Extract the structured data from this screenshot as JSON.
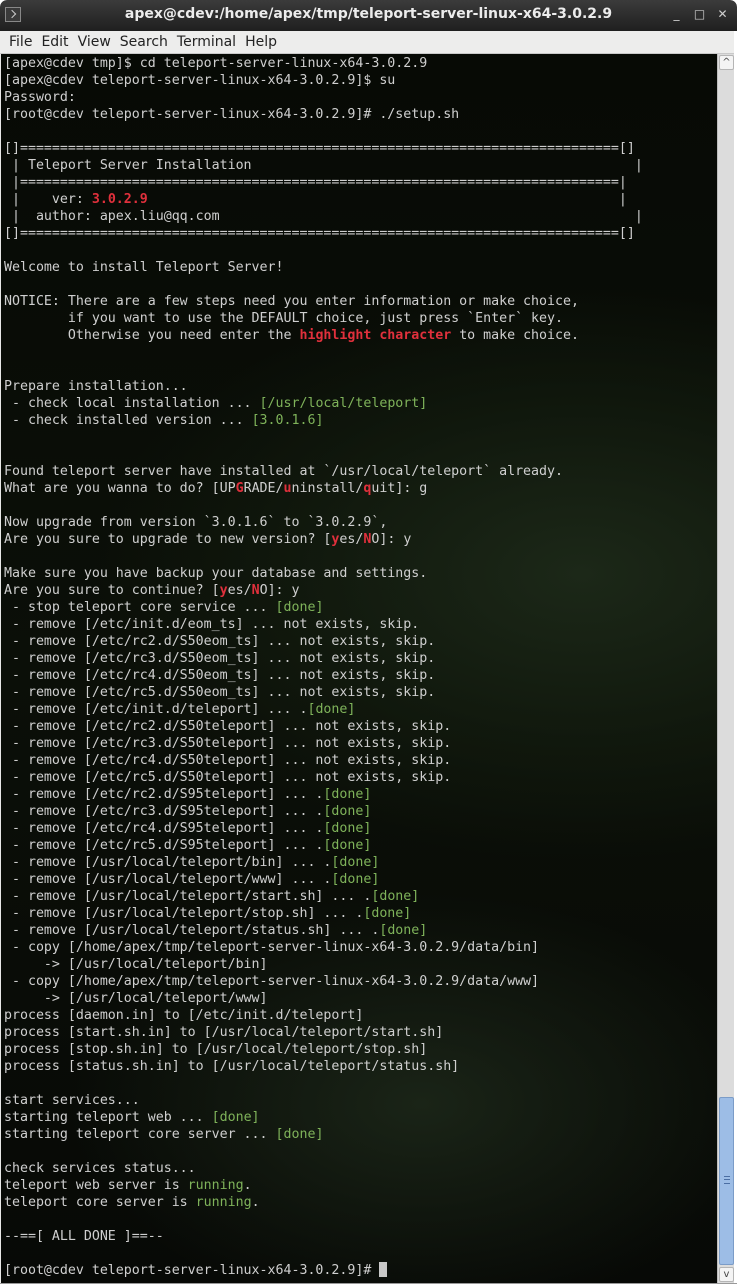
{
  "window": {
    "title": "apex@cdev:/home/apex/tmp/teleport-server-linux-x64-3.0.2.9",
    "icon": "terminal-icon",
    "controls": [
      {
        "name": "minimize",
        "glyph": "_"
      },
      {
        "name": "maximize",
        "glyph": "□"
      },
      {
        "name": "close",
        "glyph": "✕"
      }
    ]
  },
  "menu": [
    "File",
    "Edit",
    "View",
    "Search",
    "Terminal",
    "Help"
  ],
  "colors": {
    "terminal_bg": "#0a0d07",
    "text": "#cfcfcf",
    "highlight_red": "#e0303c",
    "done_green": "#7fb35a",
    "scrollbar_thumb": "#9dbde6"
  },
  "terminal": {
    "lines": [
      [
        {
          "t": "[apex@cdev tmp]$ cd teleport-server-linux-x64-3.0.2.9"
        }
      ],
      [
        {
          "t": "[apex@cdev teleport-server-linux-x64-3.0.2.9]$ su"
        }
      ],
      [
        {
          "t": "Password:"
        }
      ],
      [
        {
          "t": "[root@cdev teleport-server-linux-x64-3.0.2.9]# ./setup.sh"
        }
      ],
      [
        {
          "t": ""
        }
      ],
      [
        {
          "t": "[]===========================================================================[]"
        }
      ],
      [
        {
          "t": " | Teleport Server Installation                                                |"
        }
      ],
      [
        {
          "t": " |===========================================================================|"
        }
      ],
      [
        {
          "t": " |    ver: "
        },
        {
          "t": "3.0.2.9",
          "c": "r"
        },
        {
          "t": "                                                           |"
        }
      ],
      [
        {
          "t": " |  author: apex.liu@qq.com                                                    |"
        }
      ],
      [
        {
          "t": "[]===========================================================================[]"
        }
      ],
      [
        {
          "t": ""
        }
      ],
      [
        {
          "t": "Welcome to install Teleport Server!"
        }
      ],
      [
        {
          "t": ""
        }
      ],
      [
        {
          "t": "NOTICE: There are a few steps need you enter information or make choice,"
        }
      ],
      [
        {
          "t": "        if you want to use the DEFAULT choice, just press `Enter` key."
        }
      ],
      [
        {
          "t": "        Otherwise you need enter the "
        },
        {
          "t": "highlight character",
          "c": "r"
        },
        {
          "t": " to make choice."
        }
      ],
      [
        {
          "t": ""
        }
      ],
      [
        {
          "t": ""
        }
      ],
      [
        {
          "t": "Prepare installation..."
        }
      ],
      [
        {
          "t": " - check local installation ... "
        },
        {
          "t": "[/usr/local/teleport]",
          "c": "g"
        }
      ],
      [
        {
          "t": " - check installed version ... "
        },
        {
          "t": "[3.0.1.6]",
          "c": "g"
        }
      ],
      [
        {
          "t": ""
        }
      ],
      [
        {
          "t": ""
        }
      ],
      [
        {
          "t": "Found teleport server have installed at `/usr/local/teleport` already."
        }
      ],
      [
        {
          "t": "What are you wanna to do? [UP"
        },
        {
          "t": "G",
          "c": "r"
        },
        {
          "t": "RADE/"
        },
        {
          "t": "u",
          "c": "r"
        },
        {
          "t": "ninstall/"
        },
        {
          "t": "q",
          "c": "r"
        },
        {
          "t": "uit]: g"
        }
      ],
      [
        {
          "t": ""
        }
      ],
      [
        {
          "t": "Now upgrade from version `3.0.1.6` to `3.0.2.9`,"
        }
      ],
      [
        {
          "t": "Are you sure to upgrade to new version? ["
        },
        {
          "t": "y",
          "c": "r"
        },
        {
          "t": "es/"
        },
        {
          "t": "N",
          "c": "r"
        },
        {
          "t": "O]: y"
        }
      ],
      [
        {
          "t": ""
        }
      ],
      [
        {
          "t": "Make sure you have backup your database and settings."
        }
      ],
      [
        {
          "t": "Are you sure to continue? ["
        },
        {
          "t": "y",
          "c": "r"
        },
        {
          "t": "es/"
        },
        {
          "t": "N",
          "c": "r"
        },
        {
          "t": "O]: y"
        }
      ],
      [
        {
          "t": " - stop teleport core service ... "
        },
        {
          "t": "[done]",
          "c": "g"
        }
      ],
      [
        {
          "t": " - remove [/etc/init.d/eom_ts] ... not exists, skip."
        }
      ],
      [
        {
          "t": " - remove [/etc/rc2.d/S50eom_ts] ... not exists, skip."
        }
      ],
      [
        {
          "t": " - remove [/etc/rc3.d/S50eom_ts] ... not exists, skip."
        }
      ],
      [
        {
          "t": " - remove [/etc/rc4.d/S50eom_ts] ... not exists, skip."
        }
      ],
      [
        {
          "t": " - remove [/etc/rc5.d/S50eom_ts] ... not exists, skip."
        }
      ],
      [
        {
          "t": " - remove [/etc/init.d/teleport] ... ."
        },
        {
          "t": "[done]",
          "c": "g"
        }
      ],
      [
        {
          "t": " - remove [/etc/rc2.d/S50teleport] ... not exists, skip."
        }
      ],
      [
        {
          "t": " - remove [/etc/rc3.d/S50teleport] ... not exists, skip."
        }
      ],
      [
        {
          "t": " - remove [/etc/rc4.d/S50teleport] ... not exists, skip."
        }
      ],
      [
        {
          "t": " - remove [/etc/rc5.d/S50teleport] ... not exists, skip."
        }
      ],
      [
        {
          "t": " - remove [/etc/rc2.d/S95teleport] ... ."
        },
        {
          "t": "[done]",
          "c": "g"
        }
      ],
      [
        {
          "t": " - remove [/etc/rc3.d/S95teleport] ... ."
        },
        {
          "t": "[done]",
          "c": "g"
        }
      ],
      [
        {
          "t": " - remove [/etc/rc4.d/S95teleport] ... ."
        },
        {
          "t": "[done]",
          "c": "g"
        }
      ],
      [
        {
          "t": " - remove [/etc/rc5.d/S95teleport] ... ."
        },
        {
          "t": "[done]",
          "c": "g"
        }
      ],
      [
        {
          "t": " - remove [/usr/local/teleport/bin] ... ."
        },
        {
          "t": "[done]",
          "c": "g"
        }
      ],
      [
        {
          "t": " - remove [/usr/local/teleport/www] ... ."
        },
        {
          "t": "[done]",
          "c": "g"
        }
      ],
      [
        {
          "t": " - remove [/usr/local/teleport/start.sh] ... ."
        },
        {
          "t": "[done]",
          "c": "g"
        }
      ],
      [
        {
          "t": " - remove [/usr/local/teleport/stop.sh] ... ."
        },
        {
          "t": "[done]",
          "c": "g"
        }
      ],
      [
        {
          "t": " - remove [/usr/local/teleport/status.sh] ... ."
        },
        {
          "t": "[done]",
          "c": "g"
        }
      ],
      [
        {
          "t": " - copy [/home/apex/tmp/teleport-server-linux-x64-3.0.2.9/data/bin]"
        }
      ],
      [
        {
          "t": "     -> [/usr/local/teleport/bin]"
        }
      ],
      [
        {
          "t": " - copy [/home/apex/tmp/teleport-server-linux-x64-3.0.2.9/data/www]"
        }
      ],
      [
        {
          "t": "     -> [/usr/local/teleport/www]"
        }
      ],
      [
        {
          "t": "process [daemon.in] to [/etc/init.d/teleport]"
        }
      ],
      [
        {
          "t": "process [start.sh.in] to [/usr/local/teleport/start.sh]"
        }
      ],
      [
        {
          "t": "process [stop.sh.in] to [/usr/local/teleport/stop.sh]"
        }
      ],
      [
        {
          "t": "process [status.sh.in] to [/usr/local/teleport/status.sh]"
        }
      ],
      [
        {
          "t": ""
        }
      ],
      [
        {
          "t": "start services..."
        }
      ],
      [
        {
          "t": "starting teleport web ... "
        },
        {
          "t": "[done]",
          "c": "g"
        }
      ],
      [
        {
          "t": "starting teleport core server ... "
        },
        {
          "t": "[done]",
          "c": "g"
        }
      ],
      [
        {
          "t": ""
        }
      ],
      [
        {
          "t": "check services status..."
        }
      ],
      [
        {
          "t": "teleport web server is "
        },
        {
          "t": "running",
          "c": "g"
        },
        {
          "t": "."
        }
      ],
      [
        {
          "t": "teleport core server is "
        },
        {
          "t": "running",
          "c": "g"
        },
        {
          "t": "."
        }
      ],
      [
        {
          "t": ""
        }
      ],
      [
        {
          "t": "--==[ ALL DONE ]==--"
        }
      ],
      [
        {
          "t": ""
        }
      ],
      [
        {
          "t": "[root@cdev teleport-server-linux-x64-3.0.2.9]# "
        },
        {
          "t": "",
          "c": "cursor"
        }
      ]
    ]
  },
  "scrollbar": {
    "position_fraction": 1.0,
    "up_glyph": "^",
    "down_glyph": "v"
  }
}
